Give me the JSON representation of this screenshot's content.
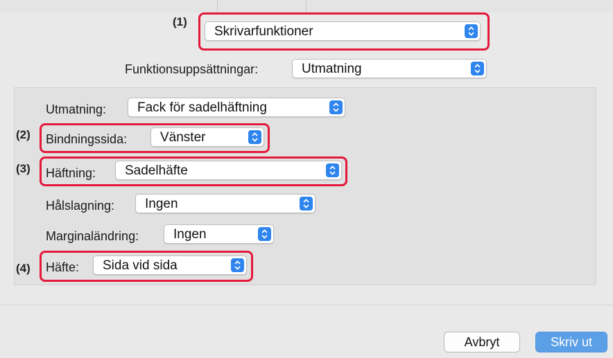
{
  "preset_menu": {
    "callout": "(1)",
    "value": "Skrivarfunktioner"
  },
  "feature_set": {
    "label": "Funktionsuppsättningar:",
    "value": "Utmatning"
  },
  "options": {
    "utmatning": {
      "label": "Utmatning:",
      "value": "Fack för sadelhäftning"
    },
    "bindningssida": {
      "callout": "(2)",
      "label": "Bindningssida:",
      "value": "Vänster"
    },
    "haftning": {
      "callout": "(3)",
      "label": "Häftning:",
      "value": "Sadelhäfte"
    },
    "halslagning": {
      "label": "Hålslagning:",
      "value": "Ingen"
    },
    "marginalandring": {
      "label": "Marginaländring:",
      "value": "Ingen"
    },
    "hafte": {
      "callout": "(4)",
      "label": "Häfte:",
      "value": "Sida vid sida"
    }
  },
  "buttons": {
    "cancel": "Avbryt",
    "print": "Skriv ut"
  },
  "colors": {
    "accent": "#2f85ee",
    "highlight": "#e3183a",
    "primary_button": "#5b9fe6"
  },
  "icons": {
    "stepper": "updown-chevrons-icon"
  }
}
